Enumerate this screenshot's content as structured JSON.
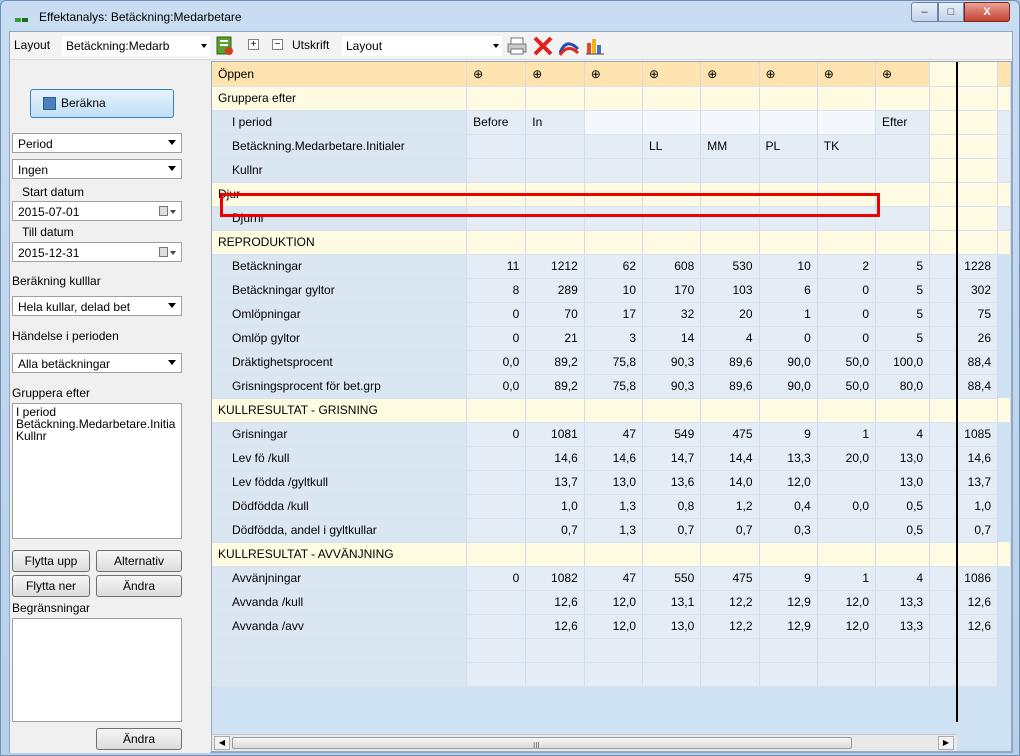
{
  "window": {
    "title": "Effektanalys: Betäckning:Medarbetare",
    "buttons": {
      "minimize": "–",
      "maximize": "□",
      "close": "X"
    },
    "accent_colors": [
      "#2f9d2f",
      "#1b6e1b"
    ]
  },
  "toolbar": {
    "layout_label": "Layout",
    "layout_value": "Betäckning:Medarb",
    "utskrift_label": "Utskrift",
    "utskrift_value": "Layout",
    "icons": [
      "filter-icon",
      "expand-icon",
      "collapse-icon",
      "print-icon",
      "delete-icon",
      "chart-line-icon",
      "chart-bar-icon"
    ]
  },
  "left": {
    "calc_button": "Beräkna",
    "period_select": "Period",
    "grouping_select": "Ingen",
    "start_label": "Start datum",
    "start_value": "2015-07-01",
    "end_label": "Till datum",
    "end_value": "2015-12-31",
    "kullar_label": "Beräkning kulllar",
    "kullar_value": "Hela kullar, delad bet",
    "handelse_label": "Händelse i perioden",
    "handelse_value": "Alla betäckningar",
    "gruppera_label": "Gruppera efter",
    "gruppera_items": [
      "I period",
      "Betäckning.Medarbetare.Initia",
      "Kullnr"
    ],
    "btn_up": "Flytta upp",
    "btn_alt": "Alternativ",
    "btn_down": "Flytta ner",
    "btn_andra": "Ändra",
    "begr_label": "Begränsningar",
    "btn_andra2": "Ändra"
  },
  "grid": {
    "top_label": "Öppen",
    "gruppera": "Gruppera efter",
    "i_period": "I period",
    "period_values": [
      "Before",
      "In",
      "",
      "",
      "",
      "",
      "",
      "Efter"
    ],
    "initialer_label": "Betäckning.Medarbetare.Initialer",
    "initialer_values": [
      "",
      "",
      "",
      "LL",
      "MM",
      "PL",
      "TK",
      ""
    ],
    "kullnr": "Kullnr",
    "djur": "Djur",
    "djurnr": "Djurnr",
    "sections": [
      {
        "title": "REPRODUKTION",
        "rows": [
          {
            "label": "Betäckningar",
            "values": [
              "11",
              "1212",
              "62",
              "608",
              "530",
              "10",
              "2",
              "5",
              "1228"
            ]
          },
          {
            "label": "Betäckningar gyltor",
            "values": [
              "8",
              "289",
              "10",
              "170",
              "103",
              "6",
              "0",
              "5",
              "302"
            ]
          },
          {
            "label": "Omlöpningar",
            "values": [
              "0",
              "70",
              "17",
              "32",
              "20",
              "1",
              "0",
              "5",
              "75"
            ]
          },
          {
            "label": "Omlöp gyltor",
            "values": [
              "0",
              "21",
              "3",
              "14",
              "4",
              "0",
              "0",
              "5",
              "26"
            ]
          },
          {
            "label": "Dräktighetsprocent",
            "values": [
              "0,0",
              "89,2",
              "75,8",
              "90,3",
              "89,6",
              "90,0",
              "50,0",
              "100,0",
              "88,4"
            ]
          },
          {
            "label": "Grisningsprocent för bet.grp",
            "values": [
              "0,0",
              "89,2",
              "75,8",
              "90,3",
              "89,6",
              "90,0",
              "50,0",
              "80,0",
              "88,4"
            ]
          }
        ]
      },
      {
        "title": "KULLRESULTAT - GRISNING",
        "rows": [
          {
            "label": "Grisningar",
            "values": [
              "0",
              "1081",
              "47",
              "549",
              "475",
              "9",
              "1",
              "4",
              "1085"
            ]
          },
          {
            "label": "Lev fö /kull",
            "values": [
              "",
              "14,6",
              "14,6",
              "14,7",
              "14,4",
              "13,3",
              "20,0",
              "13,0",
              "14,6"
            ]
          },
          {
            "label": "Lev födda /gyltkull",
            "values": [
              "",
              "13,7",
              "13,0",
              "13,6",
              "14,0",
              "12,0",
              "",
              "13,0",
              "13,7"
            ]
          },
          {
            "label": "Dödfödda /kull",
            "values": [
              "",
              "1,0",
              "1,3",
              "0,8",
              "1,2",
              "0,4",
              "0,0",
              "0,5",
              "1,0"
            ]
          },
          {
            "label": "Dödfödda, andel i gyltkullar",
            "values": [
              "",
              "0,7",
              "1,3",
              "0,7",
              "0,7",
              "0,3",
              "",
              "0,5",
              "0,7"
            ]
          }
        ]
      },
      {
        "title": "KULLRESULTAT - AVVÄNJNING",
        "rows": [
          {
            "label": "Avvänjningar",
            "values": [
              "0",
              "1082",
              "47",
              "550",
              "475",
              "9",
              "1",
              "4",
              "1086"
            ]
          },
          {
            "label": "Avvanda /kull",
            "values": [
              "",
              "12,6",
              "12,0",
              "13,1",
              "12,2",
              "12,9",
              "12,0",
              "13,3",
              "12,6"
            ]
          },
          {
            "label": "Avvanda /avv",
            "values": [
              "",
              "12,6",
              "12,0",
              "13,0",
              "12,2",
              "12,9",
              "12,0",
              "13,3",
              "12,6"
            ]
          }
        ]
      }
    ],
    "scroll_grip": "III"
  }
}
